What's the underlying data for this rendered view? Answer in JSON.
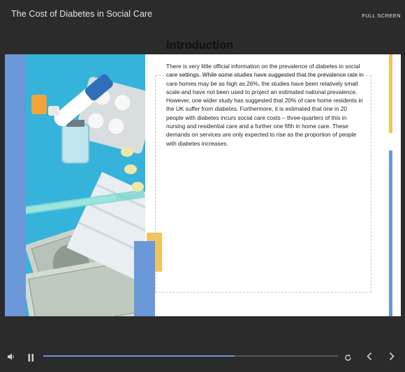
{
  "header": {
    "title": "The Cost of Diabetes in Social Care",
    "fullscreen_label": "FULL SCREEN"
  },
  "slide": {
    "heading": "Introduction",
    "body": "There is very little official information on the prevalence of diabetes in social care settings. While some studies have suggested that the prevalence rate in care homes may be as high as 26%, the studies have been relatively small scale and have not been used to project an estimated national prevalence. However, one wider study has suggested that 20% of care home residents in the UK suffer from diabetes. Furthermore, it is estimated that one in 20 people with diabetes incurs social care costs – three-quarters of this in nursing and residential care and a further one fifth in home care. These demands on services are only expected to rise as the proportion of people with diabetes increases.",
    "image": "diabetes-medical-supplies-photo"
  },
  "player": {
    "volume_icon": "speaker-icon",
    "pause_icon": "pause-icon",
    "replay_icon": "replay-icon",
    "prev_icon": "chevron-left-icon",
    "next_icon": "chevron-right-icon",
    "progress": 0.65
  },
  "colors": {
    "background": "#2b2b2b",
    "accent_blue": "#6a98d8",
    "accent_yellow": "#f3c25a",
    "photo_bg": "#36b6dc"
  }
}
